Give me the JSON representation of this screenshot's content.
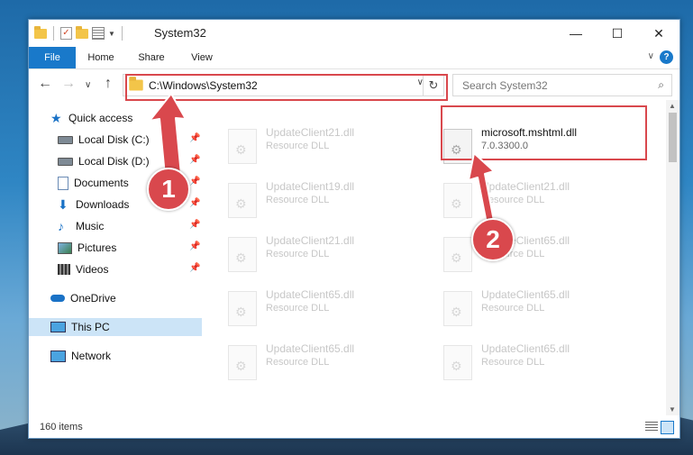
{
  "window": {
    "title": "System32",
    "controls": {
      "minimize": "—",
      "maximize": "☐",
      "close": "✕"
    }
  },
  "ribbon": {
    "tabs": [
      "File",
      "Home",
      "Share",
      "View"
    ],
    "help": "?"
  },
  "navigation": {
    "back": "←",
    "forward": "→",
    "recent": "∨",
    "up": "↑",
    "address": "C:\\Windows\\System32",
    "refresh": "↻",
    "search_placeholder": "Search System32"
  },
  "sidebar": {
    "items": [
      {
        "label": "Quick access",
        "icon": "star-icon",
        "pinned": false
      },
      {
        "label": "Local Disk (C:)",
        "icon": "drive-icon",
        "pinned": true
      },
      {
        "label": "Local Disk (D:)",
        "icon": "drive-icon",
        "pinned": true
      },
      {
        "label": "Documents",
        "icon": "documents-icon",
        "pinned": true
      },
      {
        "label": "Downloads",
        "icon": "downloads-icon",
        "pinned": true
      },
      {
        "label": "Music",
        "icon": "music-icon",
        "pinned": true
      },
      {
        "label": "Pictures",
        "icon": "pictures-icon",
        "pinned": true
      },
      {
        "label": "Videos",
        "icon": "videos-icon",
        "pinned": true
      },
      {
        "label": "OneDrive",
        "icon": "onedrive-icon",
        "pinned": false
      },
      {
        "label": "This PC",
        "icon": "this-pc-icon",
        "pinned": false,
        "selected": true
      },
      {
        "label": "Network",
        "icon": "network-icon",
        "pinned": false
      }
    ]
  },
  "files": [
    {
      "name": "UpdateClient21.dll",
      "type": "Resource DLL",
      "faded": true
    },
    {
      "name": "microsoft.mshtml.dll",
      "type": "7.0.3300.0",
      "faded": false
    },
    {
      "name": "UpdateClient19.dll",
      "type": "Resource DLL",
      "faded": true
    },
    {
      "name": "UpdateClient21.dll",
      "type": "Resource DLL",
      "faded": true
    },
    {
      "name": "UpdateClient21.dll",
      "type": "Resource DLL",
      "faded": true
    },
    {
      "name": "UpdateClient65.dll",
      "type": "Resource DLL",
      "faded": true
    },
    {
      "name": "UpdateClient65.dll",
      "type": "Resource DLL",
      "faded": true
    },
    {
      "name": "UpdateClient65.dll",
      "type": "Resource DLL",
      "faded": true
    },
    {
      "name": "UpdateClient65.dll",
      "type": "Resource DLL",
      "faded": true
    },
    {
      "name": "UpdateClient65.dll",
      "type": "Resource DLL",
      "faded": true
    }
  ],
  "status": {
    "item_count": "160 items"
  },
  "annotations": {
    "step1": "1",
    "step2": "2",
    "color": "#d9484d"
  }
}
